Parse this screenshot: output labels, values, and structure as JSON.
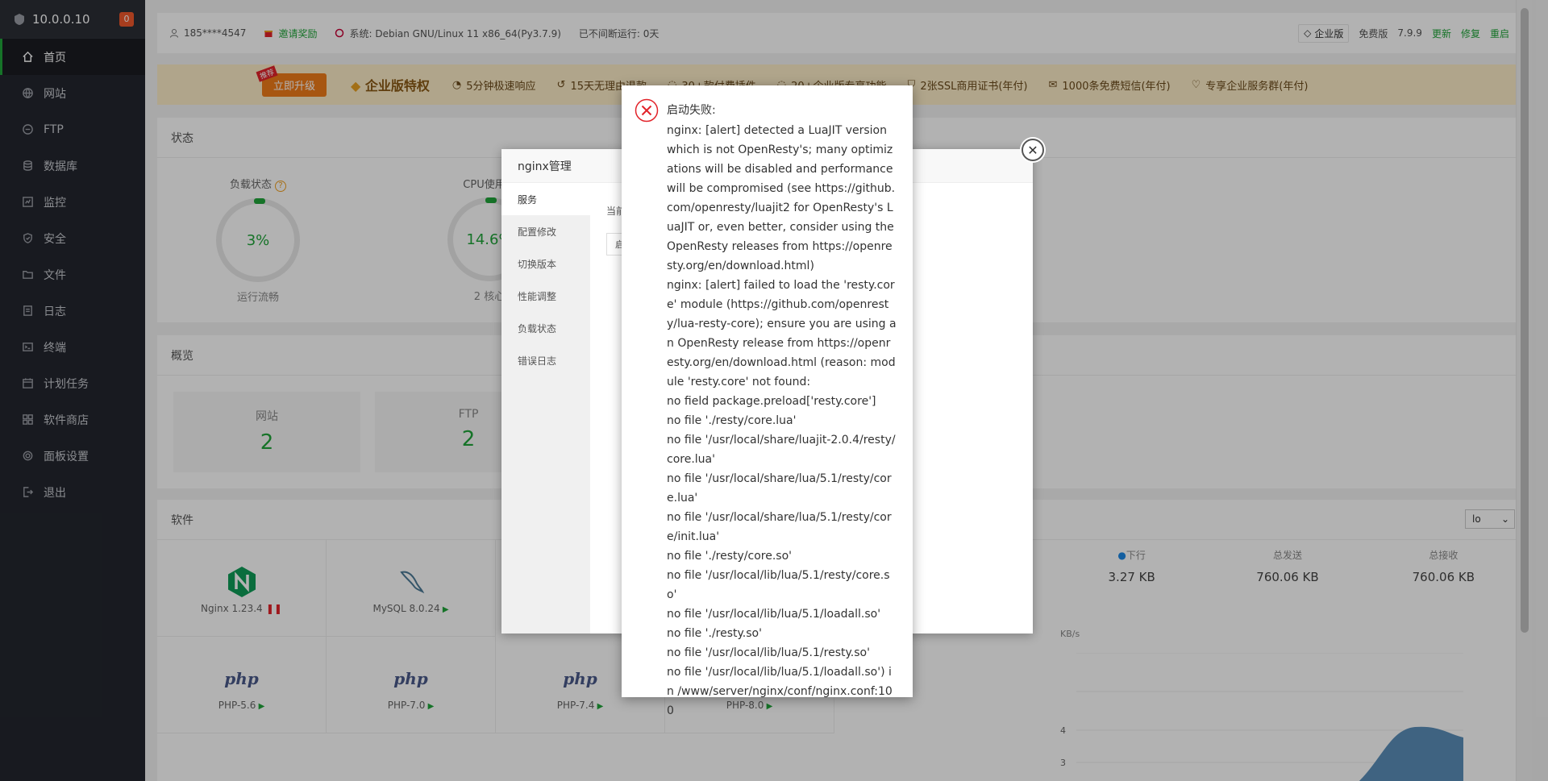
{
  "sidebar": {
    "ip": "10.0.0.10",
    "badge": "0",
    "items": [
      {
        "label": "首页",
        "icon": "home-icon"
      },
      {
        "label": "网站",
        "icon": "globe-icon"
      },
      {
        "label": "FTP",
        "icon": "ftp-icon"
      },
      {
        "label": "数据库",
        "icon": "database-icon"
      },
      {
        "label": "监控",
        "icon": "monitor-icon"
      },
      {
        "label": "安全",
        "icon": "shield-icon"
      },
      {
        "label": "文件",
        "icon": "folder-icon"
      },
      {
        "label": "日志",
        "icon": "log-icon"
      },
      {
        "label": "终端",
        "icon": "terminal-icon"
      },
      {
        "label": "计划任务",
        "icon": "calendar-icon"
      },
      {
        "label": "软件商店",
        "icon": "grid-icon"
      },
      {
        "label": "面板设置",
        "icon": "gear-icon"
      },
      {
        "label": "退出",
        "icon": "logout-icon"
      }
    ]
  },
  "topbar": {
    "user": "185****4547",
    "invite": "邀请奖励",
    "system": "系统:  Debian GNU/Linux 11 x86_64(Py3.7.9)",
    "uptime": "已不间断运行: 0天",
    "edition": "企业版",
    "free": "免费版",
    "version": "7.9.9",
    "update": "更新",
    "repair": "修复",
    "restart": "重启"
  },
  "promo": {
    "tag": "推荐",
    "upgrade": "立即升级",
    "title": "企业版特权",
    "features": [
      "5分钟极速响应",
      "15天无理由退款",
      "30+款付费插件",
      "20+企业版专享功能",
      "2张SSL商用证书(年付)",
      "1000条免费短信(年付)",
      "专享企业服务群(年付)"
    ]
  },
  "status": {
    "title": "状态",
    "load_label": "负载状态",
    "load_value": "3%",
    "load_sub": "运行流畅",
    "cpu_label": "CPU使用率",
    "cpu_value": "14.6%",
    "cpu_sub": "2 核心"
  },
  "overview": {
    "title": "概览",
    "items": [
      {
        "label": "网站",
        "value": "2"
      },
      {
        "label": "FTP",
        "value": "2"
      }
    ]
  },
  "software": {
    "title": "软件",
    "select": "lo",
    "items": [
      {
        "name": "Nginx 1.23.4"
      },
      {
        "name": "MySQL 8.0.24"
      },
      {
        "name": "PHP-5.6"
      },
      {
        "name": "PHP-7.0"
      },
      {
        "name": "PHP-7.4"
      },
      {
        "name": "PHP-8.0"
      }
    ],
    "php_logo": "php"
  },
  "traffic": {
    "down_label": "下行",
    "down_value": "3.27 KB",
    "sent_label": "总发送",
    "sent_value": "760.06 KB",
    "recv_label": "总接收",
    "recv_value": "760.06 KB",
    "unit": "KB/s",
    "ticks": [
      "4",
      "3"
    ]
  },
  "nginx_dialog": {
    "title": "nginx管理",
    "tabs": [
      "服务",
      "配置修改",
      "切换版本",
      "性能调整",
      "负载状态",
      "错误日志"
    ],
    "current": "当前",
    "button": "启"
  },
  "alert": {
    "head": "启动失败:",
    "message": "nginx: [alert] detected a LuaJIT version which is not OpenResty's; many optimizations will be disabled and performance will be compromised (see https://github.com/openresty/luajit2 for OpenResty's LuaJIT or, even better, consider using the OpenResty releases from https://openresty.org/en/download.html)\nnginx: [alert] failed to load the 'resty.core' module (https://github.com/openresty/lua-resty-core); ensure you are using an OpenResty release from https://openresty.org/en/download.html (reason: module 'resty.core' not found:\nno field package.preload['resty.core']\nno file './resty/core.lua'\nno file '/usr/local/share/luajit-2.0.4/resty/core.lua'\nno file '/usr/local/share/lua/5.1/resty/core.lua'\nno file '/usr/local/share/lua/5.1/resty/core/init.lua'\nno file './resty/core.so'\nno file '/usr/local/lib/lua/5.1/resty/core.so'\nno file '/usr/local/lib/lua/5.1/loadall.so'\nno file './resty.so'\nno file '/usr/local/lib/lua/5.1/resty.so'\nno file '/usr/local/lib/lua/5.1/loadall.so') in /www/server/nginx/conf/nginx.conf:100"
  }
}
